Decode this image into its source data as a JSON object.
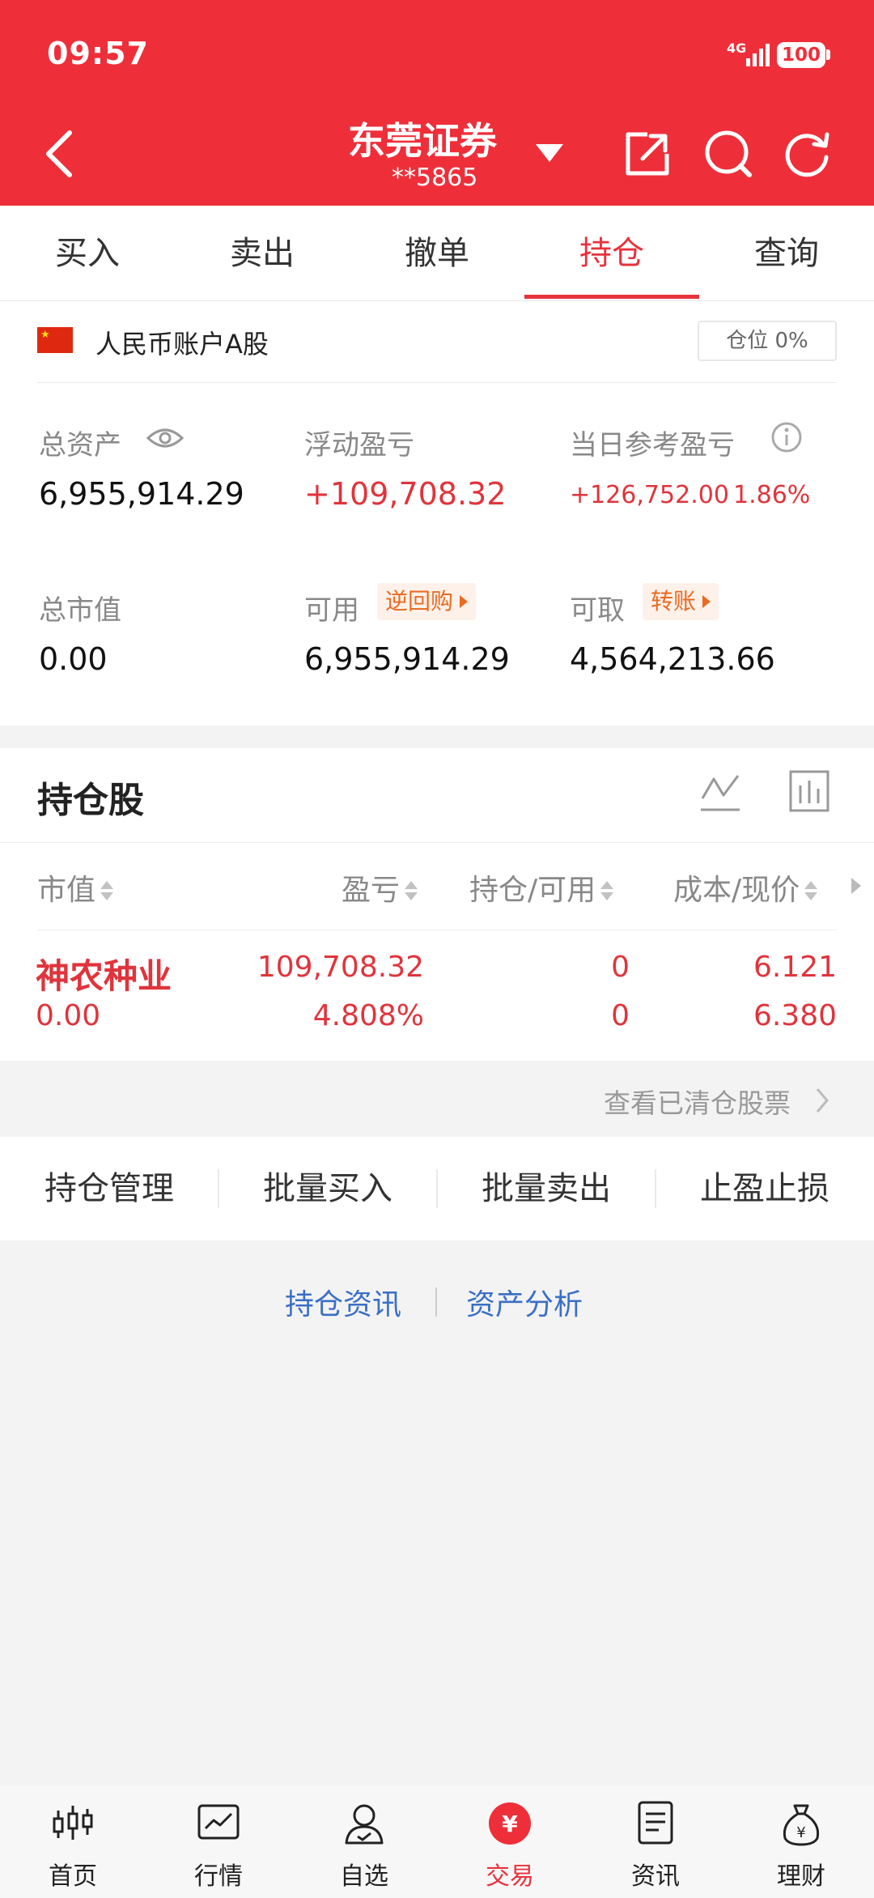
{
  "status_bar": {
    "time": "09:57",
    "network": "4G",
    "battery": "100"
  },
  "header": {
    "title": "东莞证券",
    "account": "**5865"
  },
  "tabs": [
    {
      "label": "买入"
    },
    {
      "label": "卖出"
    },
    {
      "label": "撤单"
    },
    {
      "label": "持仓",
      "active": true
    },
    {
      "label": "查询"
    }
  ],
  "account_card": {
    "type": "人民币账户A股",
    "position_badge": "仓位 0%",
    "total_assets_label": "总资产",
    "total_assets": "6,955,914.29",
    "floating_pnl_label": "浮动盈亏",
    "floating_pnl": "+109,708.32",
    "daily_pnl_label": "当日参考盈亏",
    "daily_pnl": "+126,752.00",
    "daily_pnl_pct": "1.86%",
    "market_value_label": "总市值",
    "market_value": "0.00",
    "available_label": "可用",
    "available_tag": "逆回购",
    "available": "6,955,914.29",
    "withdrawable_label": "可取",
    "withdrawable_tag": "转账",
    "withdrawable": "4,564,213.66"
  },
  "holdings": {
    "title": "持仓股",
    "columns": [
      "市值",
      "盈亏",
      "持仓/可用",
      "成本/现价"
    ],
    "rows": [
      {
        "name": "神农种业",
        "market_value": "0.00",
        "pnl": "109,708.32",
        "pnl_pct": "4.808%",
        "position": "0",
        "available": "0",
        "cost": "6.121",
        "price": "6.380"
      }
    ],
    "view_cleared": "查看已清仓股票"
  },
  "actions": [
    "持仓管理",
    "批量买入",
    "批量卖出",
    "止盈止损"
  ],
  "links": [
    "持仓资讯",
    "资产分析"
  ],
  "bottom_nav": [
    {
      "label": "首页",
      "icon": "candlestick-icon"
    },
    {
      "label": "行情",
      "icon": "market-chart-icon"
    },
    {
      "label": "自选",
      "icon": "user-watchlist-icon"
    },
    {
      "label": "交易",
      "icon": "yuan-trade-icon",
      "active": true
    },
    {
      "label": "资讯",
      "icon": "news-document-icon"
    },
    {
      "label": "理财",
      "icon": "money-bag-icon"
    }
  ],
  "colors": {
    "brand": "#ee2f3a",
    "up": "#e0343c",
    "link": "#3a6fc6",
    "tag": "#ea6b22"
  }
}
